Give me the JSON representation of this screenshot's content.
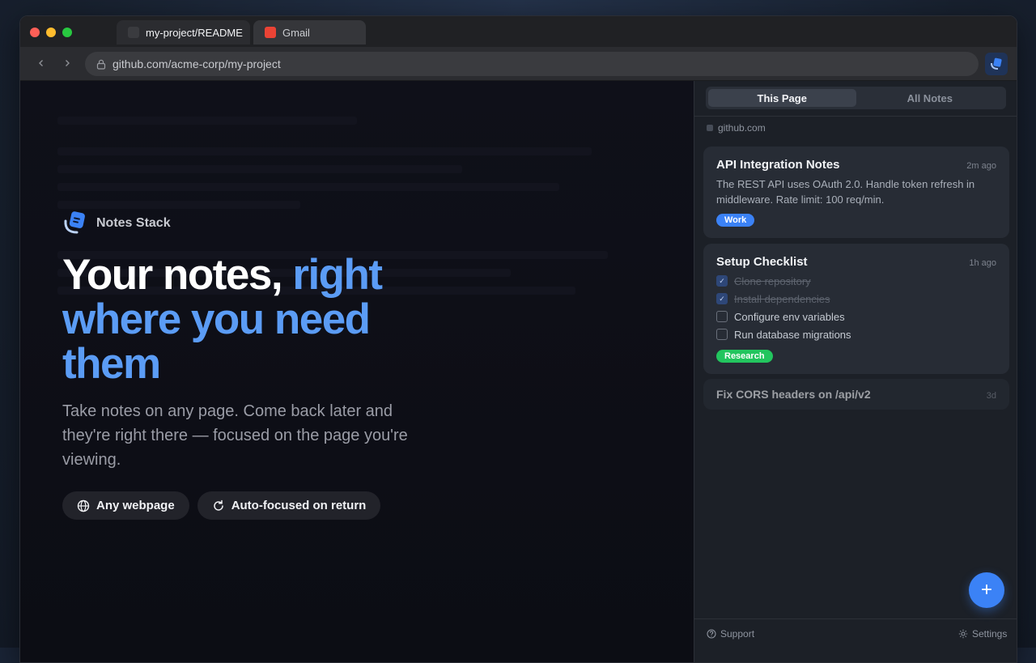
{
  "browser": {
    "tabs": [
      {
        "label": "my-project/README",
        "active": true
      },
      {
        "label": "Gmail",
        "active": false
      }
    ],
    "address": "github.com/acme-corp/my-project"
  },
  "page": {
    "brand": "Notes Stack",
    "hero_lead": "Your notes, ",
    "hero_accent": "right where you need them",
    "subtitle": "Take notes on any page. Come back later and they're right there — focused on the page you're viewing.",
    "features": [
      {
        "label": "Any webpage",
        "icon": "globe-icon"
      },
      {
        "label": "Auto-focused on return",
        "icon": "refresh-icon"
      }
    ]
  },
  "panel": {
    "tabs": [
      "This Page",
      "All Notes"
    ],
    "selected_tab": "This Page",
    "site": "github.com",
    "notes": [
      {
        "title": "API Integration Notes",
        "time": "2m ago",
        "body": "The REST API uses OAuth 2.0. Handle token refresh in middleware. Rate limit: 100 req/min.",
        "tag": "Work"
      },
      {
        "title": "Setup Checklist",
        "time": "1h ago",
        "checklist": [
          {
            "label": "Clone repository",
            "done": true
          },
          {
            "label": "Install dependencies",
            "done": true
          },
          {
            "label": "Configure env variables",
            "done": false
          },
          {
            "label": "Run database migrations",
            "done": false
          }
        ],
        "tag": "Research"
      },
      {
        "title": "Fix CORS headers on /api/v2",
        "time": "3d"
      }
    ],
    "add_label": "+",
    "footer": {
      "support": "Support",
      "settings": "Settings"
    }
  },
  "colors": {
    "accent": "#5b9cf5",
    "tag_work": "#3b82f6",
    "tag_research": "#22c55e"
  }
}
